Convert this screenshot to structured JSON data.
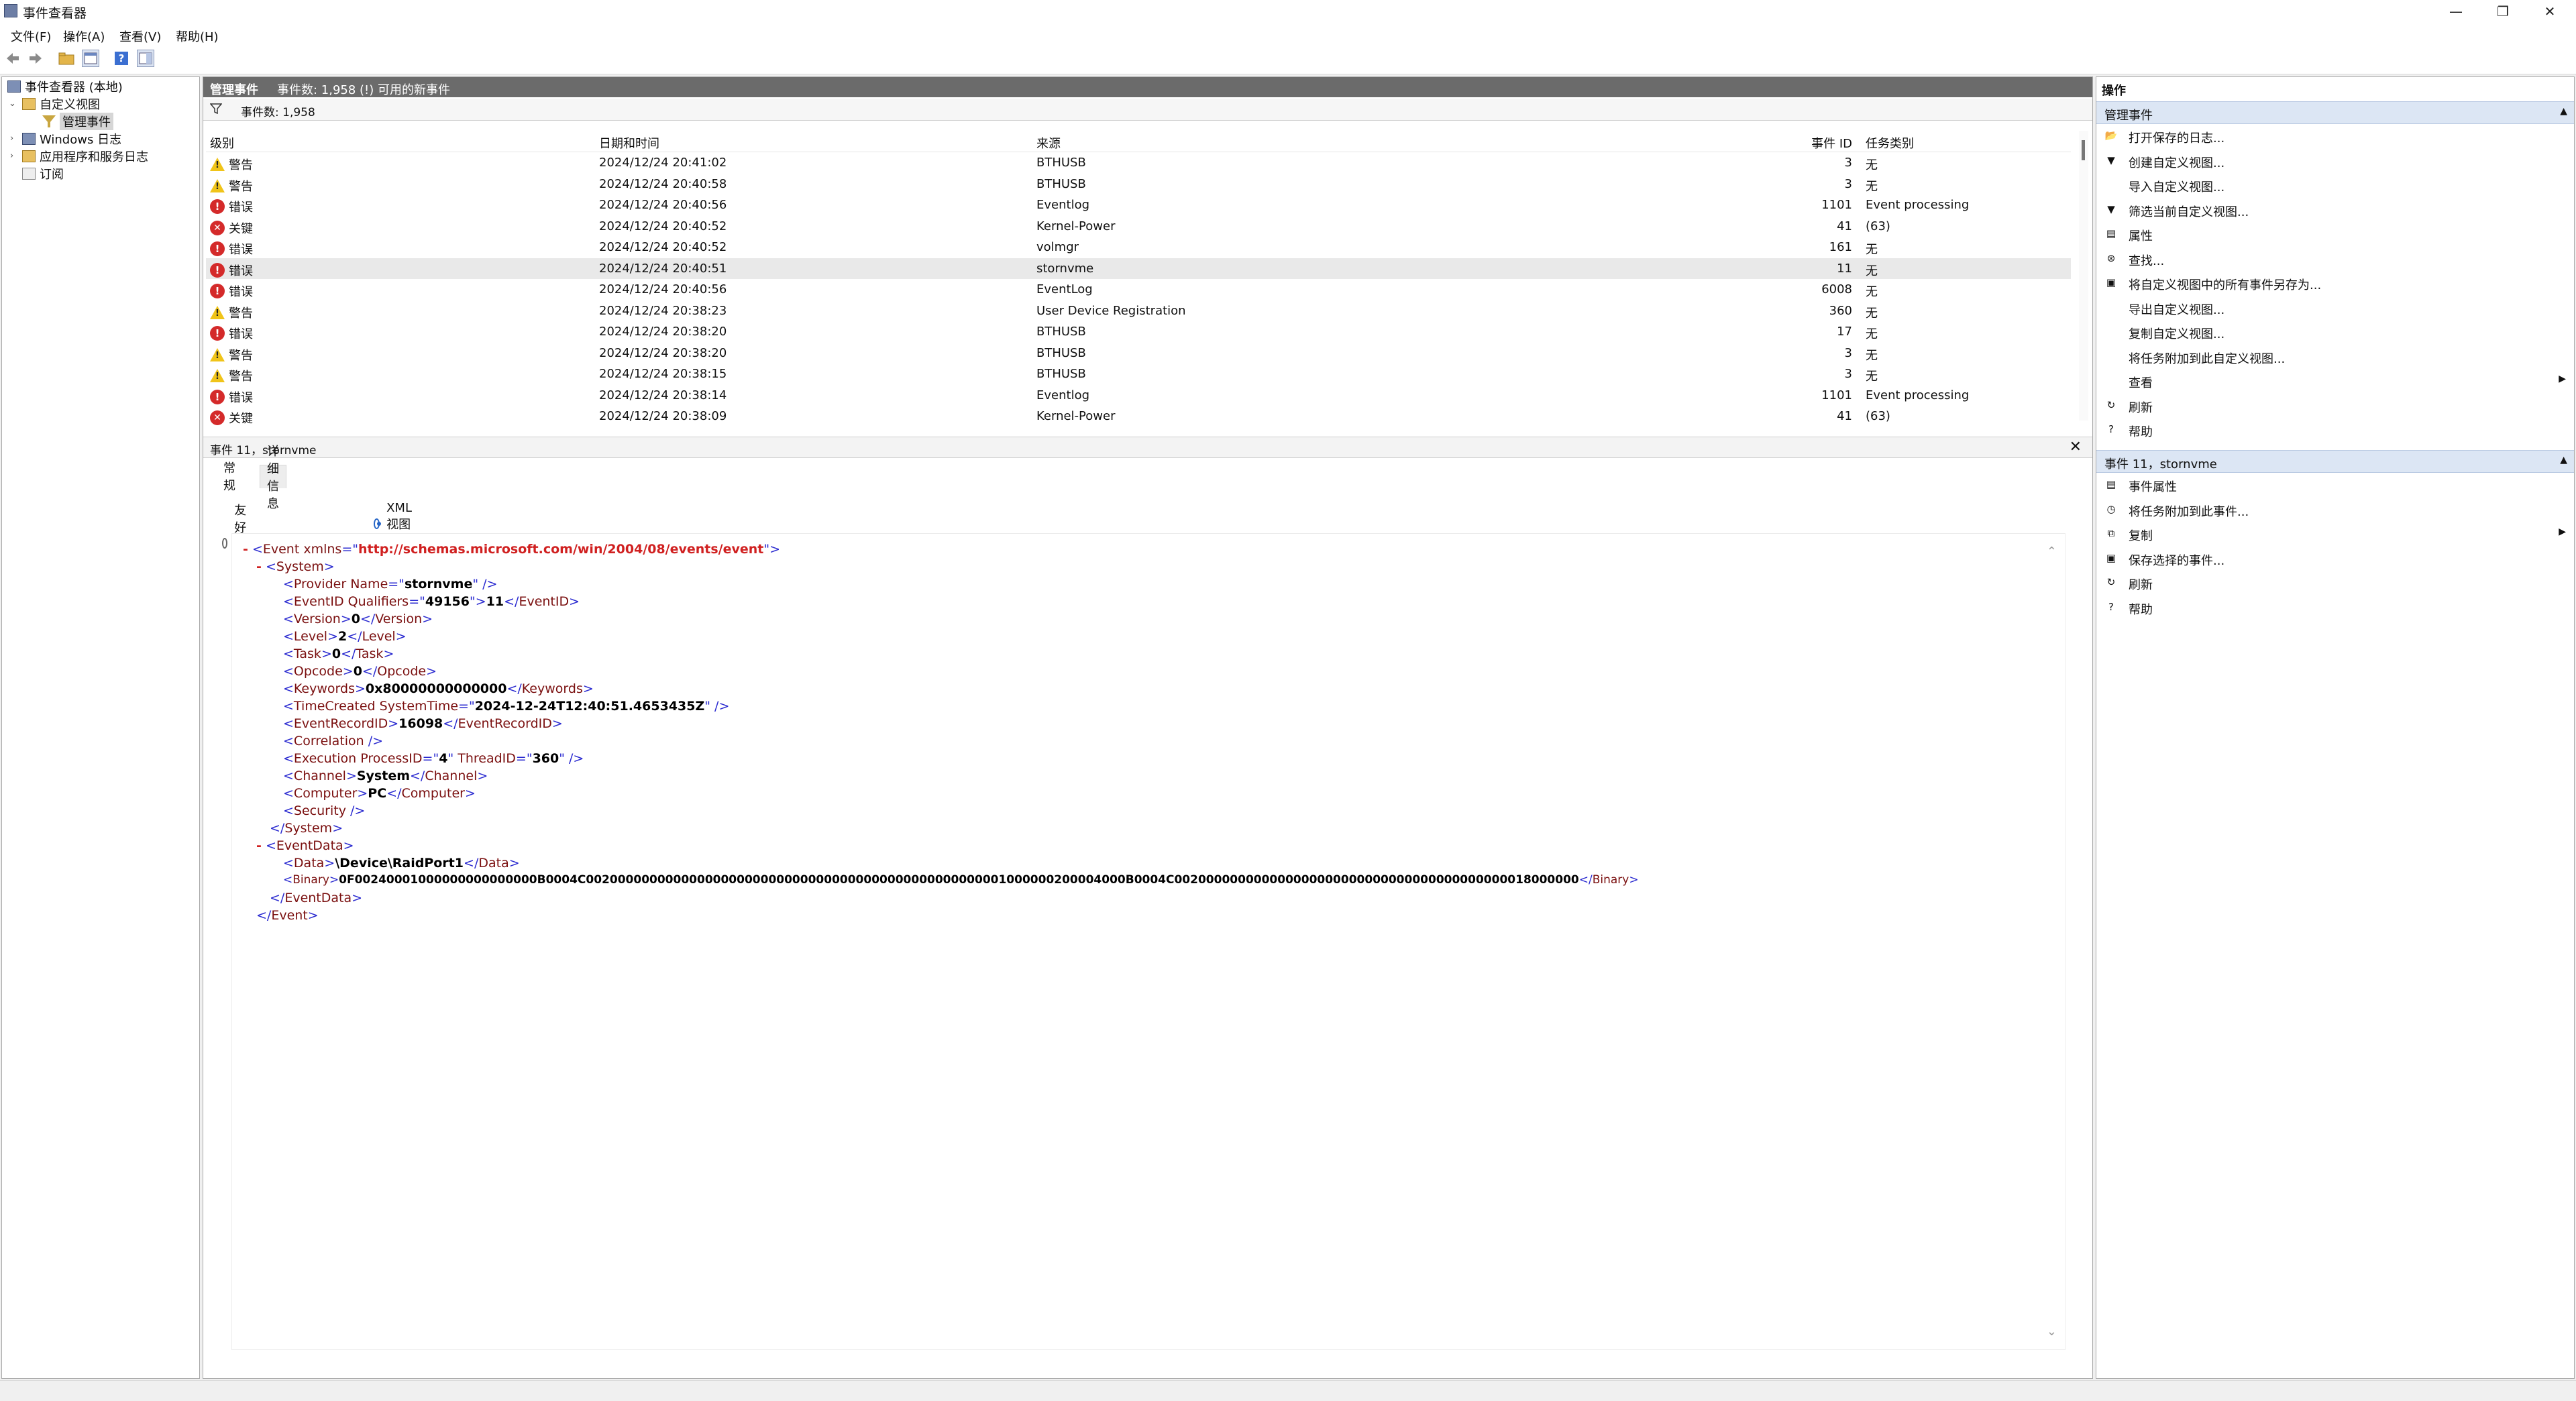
{
  "window": {
    "title": "事件查看器"
  },
  "menu": [
    "文件(F)",
    "操作(A)",
    "查看(V)",
    "帮助(H)"
  ],
  "tree": {
    "root": "事件查看器 (本地)",
    "custom_views": "自定义视图",
    "admin_events": "管理事件",
    "windows_logs": "Windows 日志",
    "app_service_logs": "应用程序和服务日志",
    "subscriptions": "订阅"
  },
  "center": {
    "header_title": "管理事件",
    "header_count": "事件数: 1,958 (!) 可用的新事件",
    "filter_label": "事件数: 1,958",
    "columns": {
      "level": "级别",
      "date": "日期和时间",
      "source": "来源",
      "event_id": "事件 ID",
      "task": "任务类别"
    },
    "events": [
      {
        "level": "警告",
        "kind": "warn",
        "date": "2024/12/24 20:41:02",
        "source": "BTHUSB",
        "event_id": "3",
        "task": "无"
      },
      {
        "level": "警告",
        "kind": "warn",
        "date": "2024/12/24 20:40:58",
        "source": "BTHUSB",
        "event_id": "3",
        "task": "无"
      },
      {
        "level": "错误",
        "kind": "err",
        "date": "2024/12/24 20:40:56",
        "source": "Eventlog",
        "event_id": "1101",
        "task": "Event processing"
      },
      {
        "level": "关键",
        "kind": "crit",
        "date": "2024/12/24 20:40:52",
        "source": "Kernel-Power",
        "event_id": "41",
        "task": "(63)"
      },
      {
        "level": "错误",
        "kind": "err",
        "date": "2024/12/24 20:40:52",
        "source": "volmgr",
        "event_id": "161",
        "task": "无"
      },
      {
        "level": "错误",
        "kind": "err",
        "date": "2024/12/24 20:40:51",
        "source": "stornvme",
        "event_id": "11",
        "task": "无"
      },
      {
        "level": "错误",
        "kind": "err",
        "date": "2024/12/24 20:40:56",
        "source": "EventLog",
        "event_id": "6008",
        "task": "无"
      },
      {
        "level": "警告",
        "kind": "warn",
        "date": "2024/12/24 20:38:23",
        "source": "User Device Registration",
        "event_id": "360",
        "task": "无"
      },
      {
        "level": "错误",
        "kind": "err",
        "date": "2024/12/24 20:38:20",
        "source": "BTHUSB",
        "event_id": "17",
        "task": "无"
      },
      {
        "level": "警告",
        "kind": "warn",
        "date": "2024/12/24 20:38:20",
        "source": "BTHUSB",
        "event_id": "3",
        "task": "无"
      },
      {
        "level": "警告",
        "kind": "warn",
        "date": "2024/12/24 20:38:15",
        "source": "BTHUSB",
        "event_id": "3",
        "task": "无"
      },
      {
        "level": "错误",
        "kind": "err",
        "date": "2024/12/24 20:38:14",
        "source": "Eventlog",
        "event_id": "1101",
        "task": "Event processing"
      },
      {
        "level": "关键",
        "kind": "crit",
        "date": "2024/12/24 20:38:09",
        "source": "Kernel-Power",
        "event_id": "41",
        "task": "(63)"
      }
    ],
    "selected_row": 5
  },
  "detail": {
    "title": "事件 11，stornvme",
    "tab_general": "常规",
    "tab_details": "详细信息",
    "radio_friendly": "友好视图(N)",
    "radio_xml": "XML 视图(X)",
    "xml": {
      "collapse": "-",
      "namespace": "http://schemas.microsoft.com/win/2004/08/events/event",
      "provider_name": "stornvme",
      "qualifiers": "49156",
      "event_id": "11",
      "version": "0",
      "level": "2",
      "task": "0",
      "opcode": "0",
      "keywords": "0x80000000000000",
      "system_time": "2024-12-24T12:40:51.4653435Z",
      "record_id": "16098",
      "process_id": "4",
      "thread_id": "360",
      "channel": "System",
      "computer": "PC",
      "data": "\\Device\\RaidPort1",
      "binary": "0F00240001000000000000000B0004C00200000000000000000000000000000000000000000000000001000000200004000B0004C002000000000000000000000000000000000000000018000000"
    }
  },
  "actions": {
    "title": "操作",
    "section1": "管理事件",
    "items1": [
      {
        "label": "打开保存的日志...",
        "icon": "folder-open-icon",
        "glyph": "📂"
      },
      {
        "label": "创建自定义视图...",
        "icon": "filter-add-icon",
        "glyph": "▼"
      },
      {
        "label": "导入自定义视图...",
        "icon": "",
        "glyph": ""
      },
      {
        "label": "筛选当前自定义视图...",
        "icon": "filter-icon",
        "glyph": "▼"
      },
      {
        "label": "属性",
        "icon": "properties-icon",
        "glyph": "▤"
      },
      {
        "label": "查找...",
        "icon": "binoculars-icon",
        "glyph": "⊛"
      },
      {
        "label": "将自定义视图中的所有事件另存为...",
        "icon": "save-icon",
        "glyph": "▣"
      },
      {
        "label": "导出自定义视图...",
        "icon": "",
        "glyph": ""
      },
      {
        "label": "复制自定义视图...",
        "icon": "",
        "glyph": ""
      },
      {
        "label": "将任务附加到此自定义视图...",
        "icon": "",
        "glyph": ""
      },
      {
        "label": "查看",
        "icon": "",
        "glyph": "",
        "sub": "▶"
      },
      {
        "label": "刷新",
        "icon": "refresh-icon",
        "glyph": "↻"
      },
      {
        "label": "帮助",
        "icon": "help-icon",
        "glyph": "?"
      }
    ],
    "section2": "事件 11，stornvme",
    "items2": [
      {
        "label": "事件属性",
        "icon": "event-properties-icon",
        "glyph": "▤"
      },
      {
        "label": "将任务附加到此事件...",
        "icon": "task-icon",
        "glyph": "◷"
      },
      {
        "label": "复制",
        "icon": "copy-icon",
        "glyph": "⧉",
        "sub": "▶"
      },
      {
        "label": "保存选择的事件...",
        "icon": "save-icon",
        "glyph": "▣"
      },
      {
        "label": "刷新",
        "icon": "refresh-icon",
        "glyph": "↻"
      },
      {
        "label": "帮助",
        "icon": "help-icon",
        "glyph": "?"
      }
    ]
  },
  "colors": {
    "header_gray": "#6b6b6b",
    "section_blue": "#dce6f4",
    "error_red": "#d42a2a",
    "warning_yellow": "#f0c419",
    "xml_tag": "#7a0f0f",
    "xml_bracket": "#2a2ad0"
  }
}
